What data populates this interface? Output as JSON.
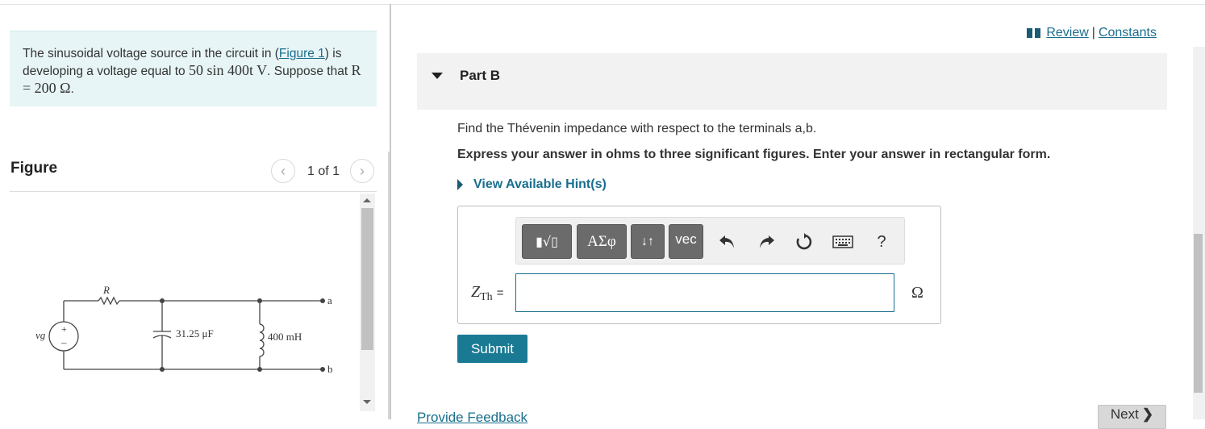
{
  "problem": {
    "text_before_link": "The sinusoidal voltage source in the circuit in (",
    "figure_link": "Figure 1",
    "text_after_link": ") is developing a voltage equal to ",
    "voltage_expr": "50 sin 400t V",
    "text_suppose": ". Suppose that ",
    "r_expr": "R = 200 Ω",
    "text_end": "."
  },
  "figure": {
    "title": "Figure",
    "pager": "1 of 1",
    "prev_icon": "chevron-left-icon",
    "next_icon": "chevron-right-icon",
    "circuit": {
      "source_label": "vg",
      "resistor_label": "R",
      "capacitor_label": "31.25 μF",
      "inductor_label": "400 mH",
      "terminal_a": "a",
      "terminal_b": "b"
    }
  },
  "header_links": {
    "review": "Review",
    "separator": "|",
    "constants": "Constants"
  },
  "part": {
    "title": "Part B",
    "question": "Find the Thévenin impedance with respect to the terminals a,b.",
    "instruction": "Express your answer in ohms to three significant figures. Enter your answer in rectangular form.",
    "hint_label": "View Available Hint(s)"
  },
  "toolbar": {
    "templates": "▮√▯",
    "greek": "ΑΣφ",
    "arrows": "↓↑",
    "vec": "vec",
    "undo_icon": "undo-icon",
    "redo_icon": "redo-icon",
    "reset_icon": "reset-icon",
    "keyboard_icon": "keyboard-icon",
    "help": "?"
  },
  "answer": {
    "variable": "Z",
    "subscript": "Th",
    "equals": "=",
    "value": "",
    "unit": "Ω"
  },
  "buttons": {
    "submit": "Submit",
    "feedback": "Provide Feedback",
    "next": "Next"
  }
}
